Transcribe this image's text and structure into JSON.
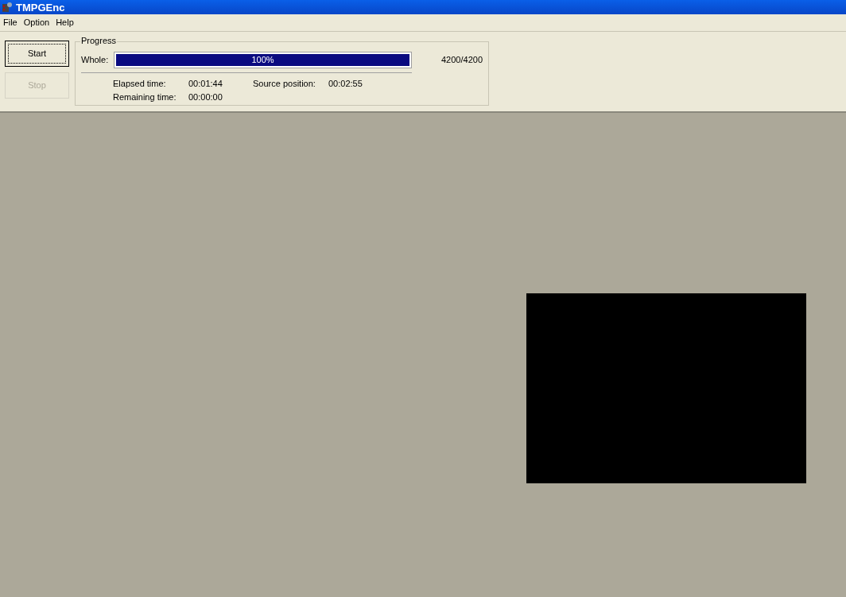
{
  "window": {
    "title": "TMPGEnc"
  },
  "menu": [
    "File",
    "Option",
    "Help"
  ],
  "buttons": [
    {
      "label": "Start",
      "disabled": false,
      "focused": true
    },
    {
      "label": "Stop",
      "disabled": true,
      "focused": false
    }
  ],
  "progress": {
    "title": "Progress",
    "label": "Whole:",
    "level": 1,
    "percent": "100%",
    "count": "4200/4200",
    "stats": [
      {
        "label": "Elapsed time:",
        "value": "00:01:44"
      },
      {
        "label": "Source position:",
        "value": "00:02:55"
      },
      {
        "label": "Remaining time:",
        "value": "00:00:00"
      }
    ]
  }
}
